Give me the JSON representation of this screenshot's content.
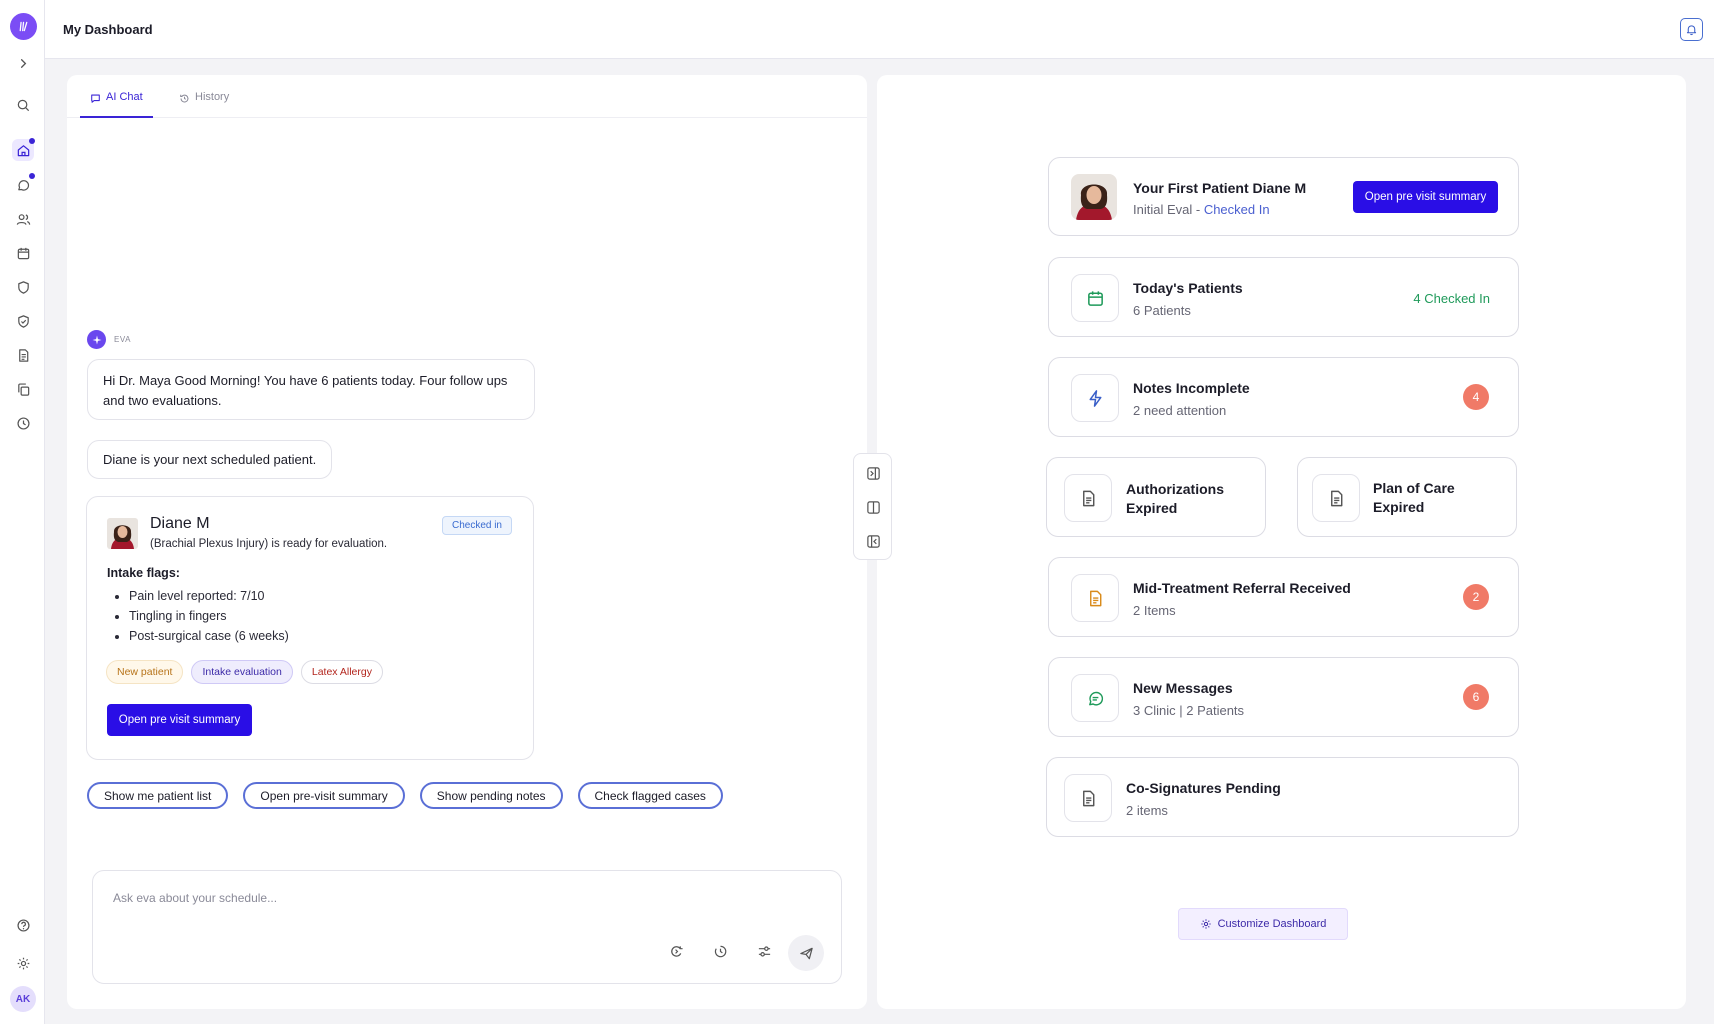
{
  "header": {
    "title": "My Dashboard"
  },
  "sidebar": {
    "user_initials": "AK"
  },
  "tabs": [
    {
      "label": "AI Chat",
      "icon": "chat-icon"
    },
    {
      "label": "History",
      "icon": "history-icon"
    }
  ],
  "chat": {
    "assistant_name": "EVA",
    "messages": [
      "Hi Dr. Maya Good Morning! You have 6 patients today. Four follow ups and two evaluations.",
      "Diane is your next scheduled patient."
    ],
    "patient_card": {
      "name": "Diane M",
      "description": "(Brachial Plexus Injury) is ready for evaluation.",
      "status": "Checked in",
      "flags_title": "Intake flags:",
      "flags": [
        "Pain level reported: 7/10",
        "Tingling in fingers",
        "Post-surgical case (6 weeks)"
      ],
      "tags": [
        "New patient",
        "Intake evaluation",
        "Latex Allergy"
      ],
      "button": "Open pre visit summary"
    },
    "suggestions": [
      "Show me patient list",
      "Open pre-visit summary",
      "Show pending notes",
      "Check flagged cases"
    ],
    "input_placeholder": "Ask eva about your schedule..."
  },
  "dashboard": {
    "first_patient": {
      "title": "Your First Patient Diane M",
      "visit_type": "Initial Eval - ",
      "status": "Checked In",
      "button": "Open pre visit summary"
    },
    "todays_patients": {
      "title": "Today's Patients",
      "sub": "6 Patients",
      "status": "4 Checked In"
    },
    "notes_incomplete": {
      "title": "Notes Incomplete",
      "sub": "2 need attention",
      "count": "4"
    },
    "authorizations": {
      "line1": "Authorizations",
      "line2": "Expired"
    },
    "plan_of_care": {
      "line1": "Plan of Care",
      "line2": "Expired"
    },
    "referral": {
      "title": "Mid-Treatment Referral Received",
      "sub": "2 Items",
      "count": "2"
    },
    "messages": {
      "title": "New Messages",
      "sub": "3 Clinic | 2 Patients",
      "count": "6"
    },
    "cosignatures": {
      "title": "Co-Signatures Pending",
      "sub": "2 items"
    },
    "customize_label": "Customize Dashboard"
  },
  "colors": {
    "primary": "#2a0ee6",
    "accent": "#6a47ee",
    "success": "#1f9a5a",
    "alert": "#f07a67"
  }
}
